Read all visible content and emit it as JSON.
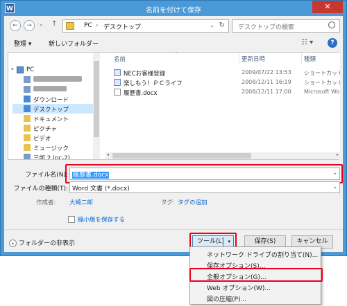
{
  "window": {
    "title": "名前を付けて保存",
    "app_icon_text": "W",
    "close_glyph": "✕"
  },
  "nav": {
    "back": "←",
    "forward": "→",
    "dropdown": "⌄",
    "up": "↑"
  },
  "address": {
    "crumbs": [
      "PC",
      "›",
      "デスクトップ"
    ],
    "dropdown": "⌄",
    "refresh": "↻"
  },
  "search": {
    "placeholder": "デスクトップの検索"
  },
  "toolbar": {
    "organize": "整理 ▾",
    "new_folder": "新しいフォルダー",
    "view": "☷ ▾",
    "help": "?"
  },
  "sidebar": {
    "pc_label": "PC",
    "items": [
      {
        "label": "ダウンロード"
      },
      {
        "label": "デスクトップ"
      },
      {
        "label": "ドキュメント"
      },
      {
        "label": "ピクチャ"
      },
      {
        "label": "ビデオ"
      },
      {
        "label": "ミュージック"
      },
      {
        "label": "三郎 2 (pc-2)"
      }
    ]
  },
  "file_list": {
    "columns": [
      "名前",
      "更新日時",
      "種類"
    ],
    "sort_caret": "^",
    "rows": [
      {
        "name": "NECお客様登録",
        "date": "2009/07/22 13:53",
        "type": "ショートカット"
      },
      {
        "name": "楽しもう！ＰＣライフ",
        "date": "2008/12/11 16:19",
        "type": "ショートカット"
      },
      {
        "name": "履歴書.docx",
        "date": "2008/12/11 17:00",
        "type": "Microsoft Word"
      }
    ],
    "scroll_left": "◂",
    "scroll_right": "▸"
  },
  "form": {
    "filename_label": "ファイル名(N):",
    "filename_value": "履歴書.docx",
    "filetype_label": "ファイルの種類(T):",
    "filetype_value": "Word 文書 (*.docx)",
    "dropdown": "⌄",
    "author_label": "作成者:",
    "author_value": "大崎二郎",
    "tags_label": "タグ:",
    "tags_value": "タグの追加",
    "thumbnail_label": "縮小版を保存する"
  },
  "footer": {
    "hide_folders": "フォルダーの非表示",
    "hide_icon": "▴",
    "tools_label": "ツール(L)",
    "tools_arrow": "▾",
    "save_label": "保存(S)",
    "cancel_label": "キャンセル"
  },
  "tools_menu": {
    "items": [
      "ネットワーク ドライブの割り当て(N)...",
      "保存オプション(S)...",
      "全般オプション(G)...",
      "Web オプション(W)...",
      "図の圧縮(P)..."
    ]
  },
  "colors": {
    "highlight_box": "#e8001c",
    "title_bar": "#4a9ad8",
    "selection": "#3399ff"
  }
}
